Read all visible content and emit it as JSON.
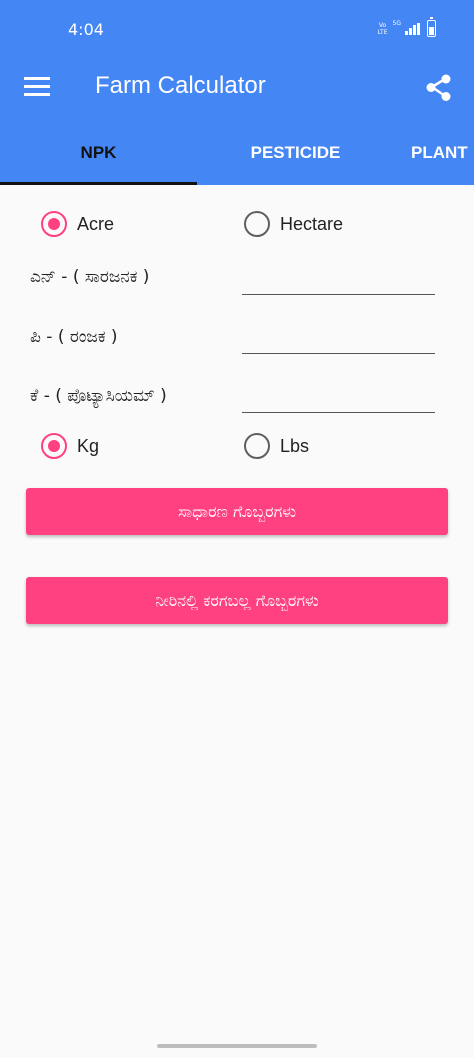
{
  "status_bar": {
    "time": "4:04",
    "volte": "Vo LTE",
    "network": "5G"
  },
  "toolbar": {
    "title": "Farm Calculator",
    "menu_icon": "hamburger-menu-icon",
    "share_icon": "share-icon"
  },
  "tabs": [
    {
      "label": "NPK",
      "selected": true
    },
    {
      "label": "PESTICIDE",
      "selected": false
    },
    {
      "label": "PLANT",
      "selected": false
    }
  ],
  "area_unit": {
    "options": [
      "Acre",
      "Hectare"
    ],
    "selected": "Acre"
  },
  "fields": [
    {
      "label": "ಎನ್ - ( ಸಾರಜನಕ )",
      "value": ""
    },
    {
      "label": "ಪಿ - ( ರಂಜಕ )",
      "value": ""
    },
    {
      "label": "ಕೆ - ( ಪೊಟ್ಯಾಸಿಯಮ್ )",
      "value": ""
    }
  ],
  "weight_unit": {
    "options": [
      "Kg",
      "Lbs"
    ],
    "selected": "Kg"
  },
  "buttons": {
    "normal_fertilizers": "ಸಾಧಾರಣ ಗೊಬ್ಬರಗಳು",
    "water_soluble_fertilizers": "ನೀರಿನಲ್ಲಿ ಕರಗಬಲ್ಲ ಗೊಬ್ಬರಗಳು"
  },
  "colors": {
    "primary": "#4486f4",
    "accent": "#ff4081",
    "background": "#fafafa"
  }
}
